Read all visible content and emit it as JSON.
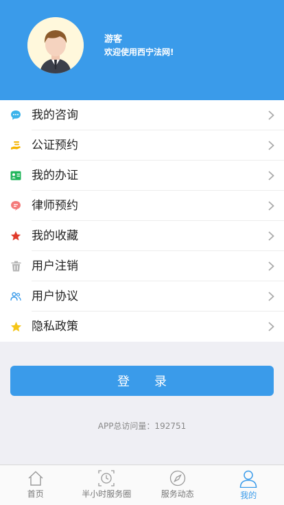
{
  "profile": {
    "name": "游客",
    "welcome": "欢迎使用西宁法网!"
  },
  "menu": [
    {
      "label": "我的咨询",
      "icon": "chat-icon",
      "color": "#3bb3ea"
    },
    {
      "label": "公证预约",
      "icon": "hand-money-icon",
      "color": "#f5b300"
    },
    {
      "label": "我的办证",
      "icon": "id-card-icon",
      "color": "#1fb55a"
    },
    {
      "label": "律师预约",
      "icon": "message-bubble-icon",
      "color": "#f47a7a"
    },
    {
      "label": "我的收藏",
      "icon": "star-icon",
      "color": "#e03a2a"
    },
    {
      "label": "用户注销",
      "icon": "trash-icon",
      "color": "#b5b5b5"
    },
    {
      "label": "用户协议",
      "icon": "users-icon",
      "color": "#3a9bea"
    },
    {
      "label": "隐私政策",
      "icon": "star-icon",
      "color": "#f5c518"
    }
  ],
  "login": {
    "char1": "登",
    "char2": "录"
  },
  "visit_text": "APP总访问量：192751",
  "tabs": [
    {
      "label": "首页",
      "icon": "home-icon"
    },
    {
      "label": "半小时服务圈",
      "icon": "clock-icon"
    },
    {
      "label": "服务动态",
      "icon": "compass-icon"
    },
    {
      "label": "我的",
      "icon": "person-icon",
      "active": true
    }
  ],
  "colors": {
    "primary": "#3a9bea",
    "background": "#efeff4"
  }
}
